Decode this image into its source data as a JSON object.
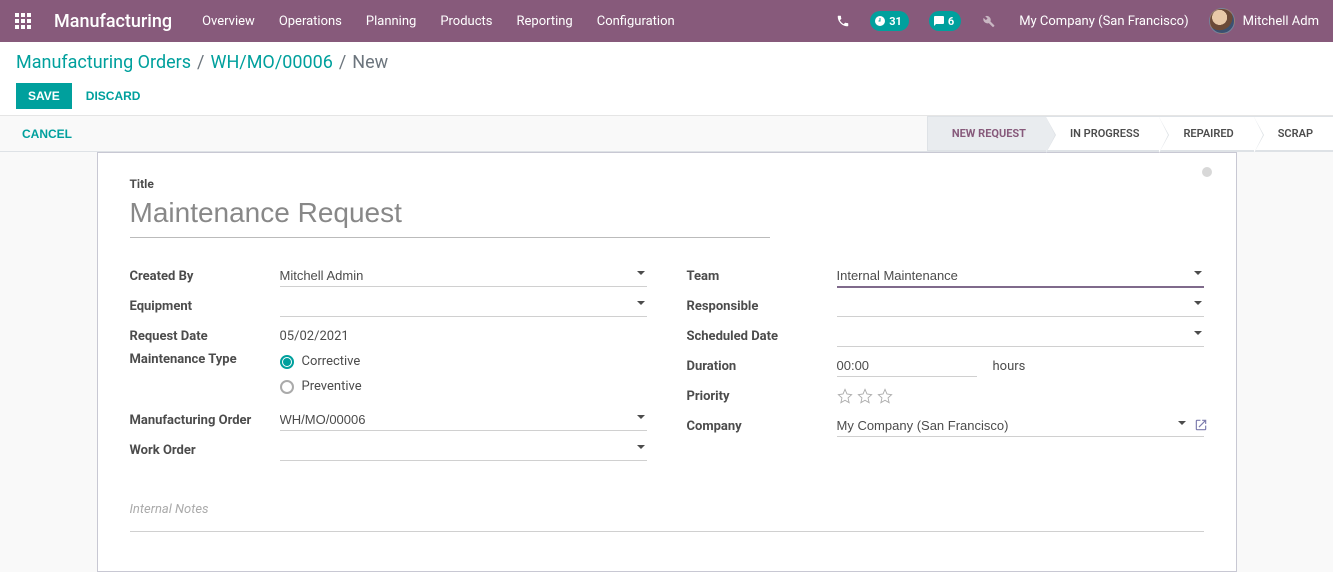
{
  "nav": {
    "app_title": "Manufacturing",
    "menu": [
      "Overview",
      "Operations",
      "Planning",
      "Products",
      "Reporting",
      "Configuration"
    ],
    "clock_count": "31",
    "chat_count": "6",
    "company": "My Company (San Francisco)",
    "user": "Mitchell Adm"
  },
  "breadcrumb": {
    "items": [
      "Manufacturing Orders",
      "WH/MO/00006"
    ],
    "current": "New"
  },
  "buttons": {
    "save": "Save",
    "discard": "Discard",
    "cancel": "Cancel"
  },
  "status_steps": [
    "New Request",
    "In Progress",
    "Repaired",
    "Scrap"
  ],
  "form": {
    "title_label": "Title",
    "title_placeholder": "Maintenance Request",
    "left": {
      "created_by": {
        "label": "Created By",
        "value": "Mitchell Admin"
      },
      "equipment": {
        "label": "Equipment",
        "value": ""
      },
      "request_date": {
        "label": "Request Date",
        "value": "05/02/2021"
      },
      "maintenance_type": {
        "label": "Maintenance Type",
        "options": [
          "Corrective",
          "Preventive"
        ],
        "selected": "Corrective"
      },
      "manufacturing_order": {
        "label": "Manufacturing Order",
        "value": "WH/MO/00006"
      },
      "work_order": {
        "label": "Work Order",
        "value": ""
      }
    },
    "right": {
      "team": {
        "label": "Team",
        "value": "Internal Maintenance"
      },
      "responsible": {
        "label": "Responsible",
        "value": ""
      },
      "scheduled_date": {
        "label": "Scheduled Date",
        "value": ""
      },
      "duration": {
        "label": "Duration",
        "value": "00:00",
        "unit": "hours"
      },
      "priority": {
        "label": "Priority",
        "stars": 3,
        "value": 0
      },
      "company": {
        "label": "Company",
        "value": "My Company (San Francisco)"
      }
    },
    "notes_placeholder": "Internal Notes"
  }
}
